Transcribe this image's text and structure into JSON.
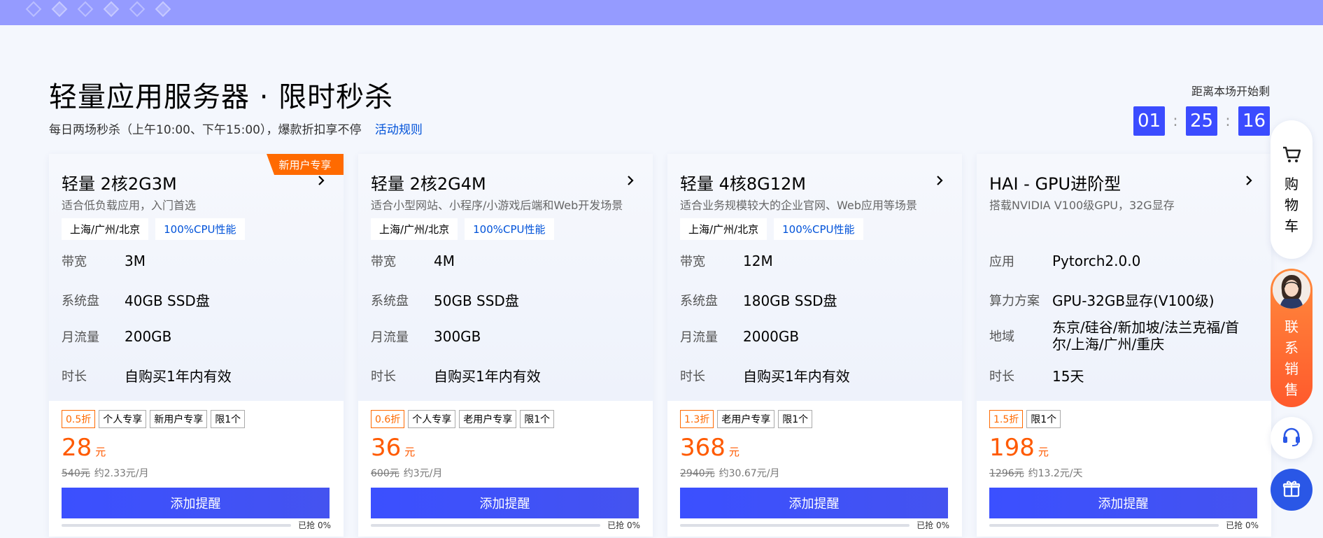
{
  "page": {
    "title": "轻量应用服务器 · 限时秒杀",
    "subtitle": "每日两场秒杀（上午10:00、下午15:00），爆款折扣享不停",
    "rules_link": "活动规则"
  },
  "countdown": {
    "label": "距离本场开始剩",
    "hours": "01",
    "minutes": "25",
    "seconds": "16",
    "separator": ":"
  },
  "cards": [
    {
      "ribbon": "新用户专享",
      "name": "轻量 2核2G3M",
      "desc": "适合低负载应用，入门首选",
      "tags": [
        "上海/广州/北京",
        "100%CPU性能"
      ],
      "specs": [
        {
          "k": "带宽",
          "v": "3M"
        },
        {
          "k": "系统盘",
          "v": "40GB SSD盘"
        },
        {
          "k": "月流量",
          "v": "200GB"
        },
        {
          "k": "时长",
          "v": "自购买1年内有效"
        }
      ],
      "discount": "0.5折",
      "labels": [
        "个人专享",
        "新用户专享",
        "限1个"
      ],
      "price": "28",
      "unit": "元",
      "original": "540元",
      "per": "约2.33元/月",
      "button": "添加提醒",
      "progress_text": "已抢 0%",
      "progress": 0
    },
    {
      "ribbon": "",
      "name": "轻量 2核2G4M",
      "desc": "适合小型网站、小程序/小游戏后端和Web开发场景",
      "tags": [
        "上海/广州/北京",
        "100%CPU性能"
      ],
      "specs": [
        {
          "k": "带宽",
          "v": "4M"
        },
        {
          "k": "系统盘",
          "v": "50GB SSD盘"
        },
        {
          "k": "月流量",
          "v": "300GB"
        },
        {
          "k": "时长",
          "v": "自购买1年内有效"
        }
      ],
      "discount": "0.6折",
      "labels": [
        "个人专享",
        "老用户专享",
        "限1个"
      ],
      "price": "36",
      "unit": "元",
      "original": "600元",
      "per": "约3元/月",
      "button": "添加提醒",
      "progress_text": "已抢 0%",
      "progress": 0
    },
    {
      "ribbon": "",
      "name": "轻量 4核8G12M",
      "desc": "适合业务规模较大的企业官网、Web应用等场景",
      "tags": [
        "上海/广州/北京",
        "100%CPU性能"
      ],
      "specs": [
        {
          "k": "带宽",
          "v": "12M"
        },
        {
          "k": "系统盘",
          "v": "180GB SSD盘"
        },
        {
          "k": "月流量",
          "v": "2000GB"
        },
        {
          "k": "时长",
          "v": "自购买1年内有效"
        }
      ],
      "discount": "1.3折",
      "labels": [
        "老用户专享",
        "限1个"
      ],
      "price": "368",
      "unit": "元",
      "original": "2940元",
      "per": "约30.67元/月",
      "button": "添加提醒",
      "progress_text": "已抢 0%",
      "progress": 0
    },
    {
      "ribbon": "",
      "name": "HAI - GPU进阶型",
      "desc": "搭载NVIDIA V100级GPU，32G显存",
      "tags": [],
      "specs": [
        {
          "k": "应用",
          "v": "Pytorch2.0.0"
        },
        {
          "k": "算力方案",
          "v": "GPU-32GB显存(V100级)"
        },
        {
          "k": "地域",
          "v": "东京/硅谷/新加坡/法兰克福/首尔/上海/广州/重庆"
        },
        {
          "k": "时长",
          "v": "15天"
        }
      ],
      "discount": "1.5折",
      "labels": [
        "限1个"
      ],
      "price": "198",
      "unit": "元",
      "original": "1296元",
      "per": "约13.2元/天",
      "button": "添加提醒",
      "progress_text": "已抢 0%",
      "progress": 0
    }
  ],
  "float": {
    "cart": "购物车",
    "sales": "联系销售"
  },
  "colors": {
    "accent": "#3b4cff",
    "price": "#ff5a00",
    "ribbon": "#ff6a00",
    "link": "#0052d9",
    "top_band": "#959bff"
  }
}
